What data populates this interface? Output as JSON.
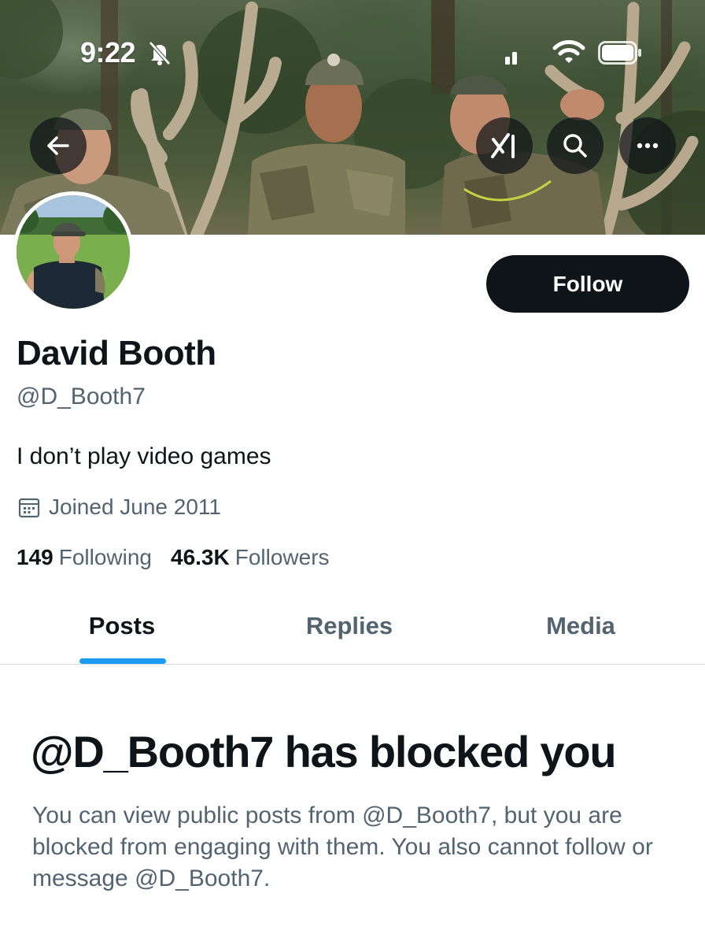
{
  "status_bar": {
    "time": "9:22",
    "icons": [
      "bell-slash-icon",
      "cellular-signal-icon",
      "wifi-icon",
      "battery-icon"
    ]
  },
  "nav": {
    "back_icon": "arrow-left-icon",
    "grok_icon": "grok-icon",
    "search_icon": "search-icon",
    "more_icon": "more-horizontal-icon"
  },
  "profile": {
    "display_name": "David Booth",
    "handle": "@D_Booth7",
    "bio": "I don’t play video games",
    "joined": "Joined June 2011",
    "following_count": "149",
    "following_label": "Following",
    "followers_count": "46.3K",
    "followers_label": "Followers"
  },
  "actions": {
    "follow_label": "Follow"
  },
  "tabs": [
    {
      "label": "Posts",
      "active": true
    },
    {
      "label": "Replies",
      "active": false
    },
    {
      "label": "Media",
      "active": false
    }
  ],
  "blocked_notice": {
    "title": "@D_Booth7 has blocked you",
    "body": "You can view public posts from @D_Booth7, but you are blocked from engaging with them. You also cannot follow or message @D_Booth7."
  },
  "colors": {
    "text_primary": "#0f1419",
    "text_secondary": "#536471",
    "accent_blue": "#1d9bf0",
    "follow_button_bg": "#0f1419"
  }
}
